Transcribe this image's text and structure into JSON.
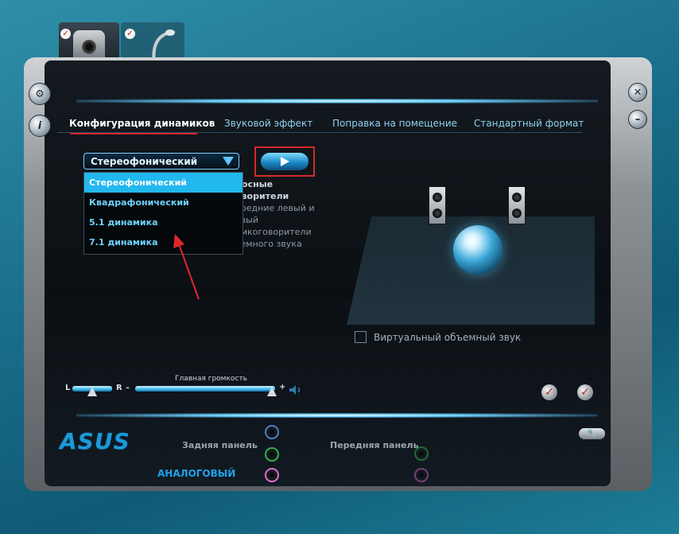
{
  "tabs": [
    {
      "label": "Конфигурация динамиков",
      "active": true
    },
    {
      "label": "Звуковой эффект",
      "active": false
    },
    {
      "label": "Поправка на помещение",
      "active": false
    },
    {
      "label": "Стандартный формат",
      "active": false
    }
  ],
  "speaker_config": {
    "selected": "Стереофонический",
    "options": [
      "Стереофонический",
      "Квадрафонический",
      "5.1 динамика",
      "7.1 динамика"
    ],
    "description": [
      "лосные",
      "оворители",
      "ередние левый и",
      "авый",
      "омкоговорители",
      "ьемного звука"
    ]
  },
  "virtual_surround": {
    "label": "Виртуальный объемный звук",
    "checked": false
  },
  "volume": {
    "label": "Главная громкость",
    "left_label": "L",
    "right_label": "R",
    "minus": "–",
    "plus": "+",
    "balance": 0.5,
    "level": 0.98
  },
  "brand": "ASUS",
  "jacks": {
    "rear_label": "Задняя панель",
    "front_label": "Передняя панель",
    "analog_label": "АНАЛОГОВЫЙ",
    "colors": {
      "blue": "#4b7fbf",
      "green": "#2fb24a",
      "pink": "#e06fc8"
    }
  },
  "accent_color": "#22b8ee",
  "icons": [
    "webcam-icon",
    "microphone-icon",
    "settings-icon",
    "info-icon",
    "close-icon",
    "minimize-icon",
    "play-icon",
    "check-icon",
    "wrench-icon"
  ]
}
